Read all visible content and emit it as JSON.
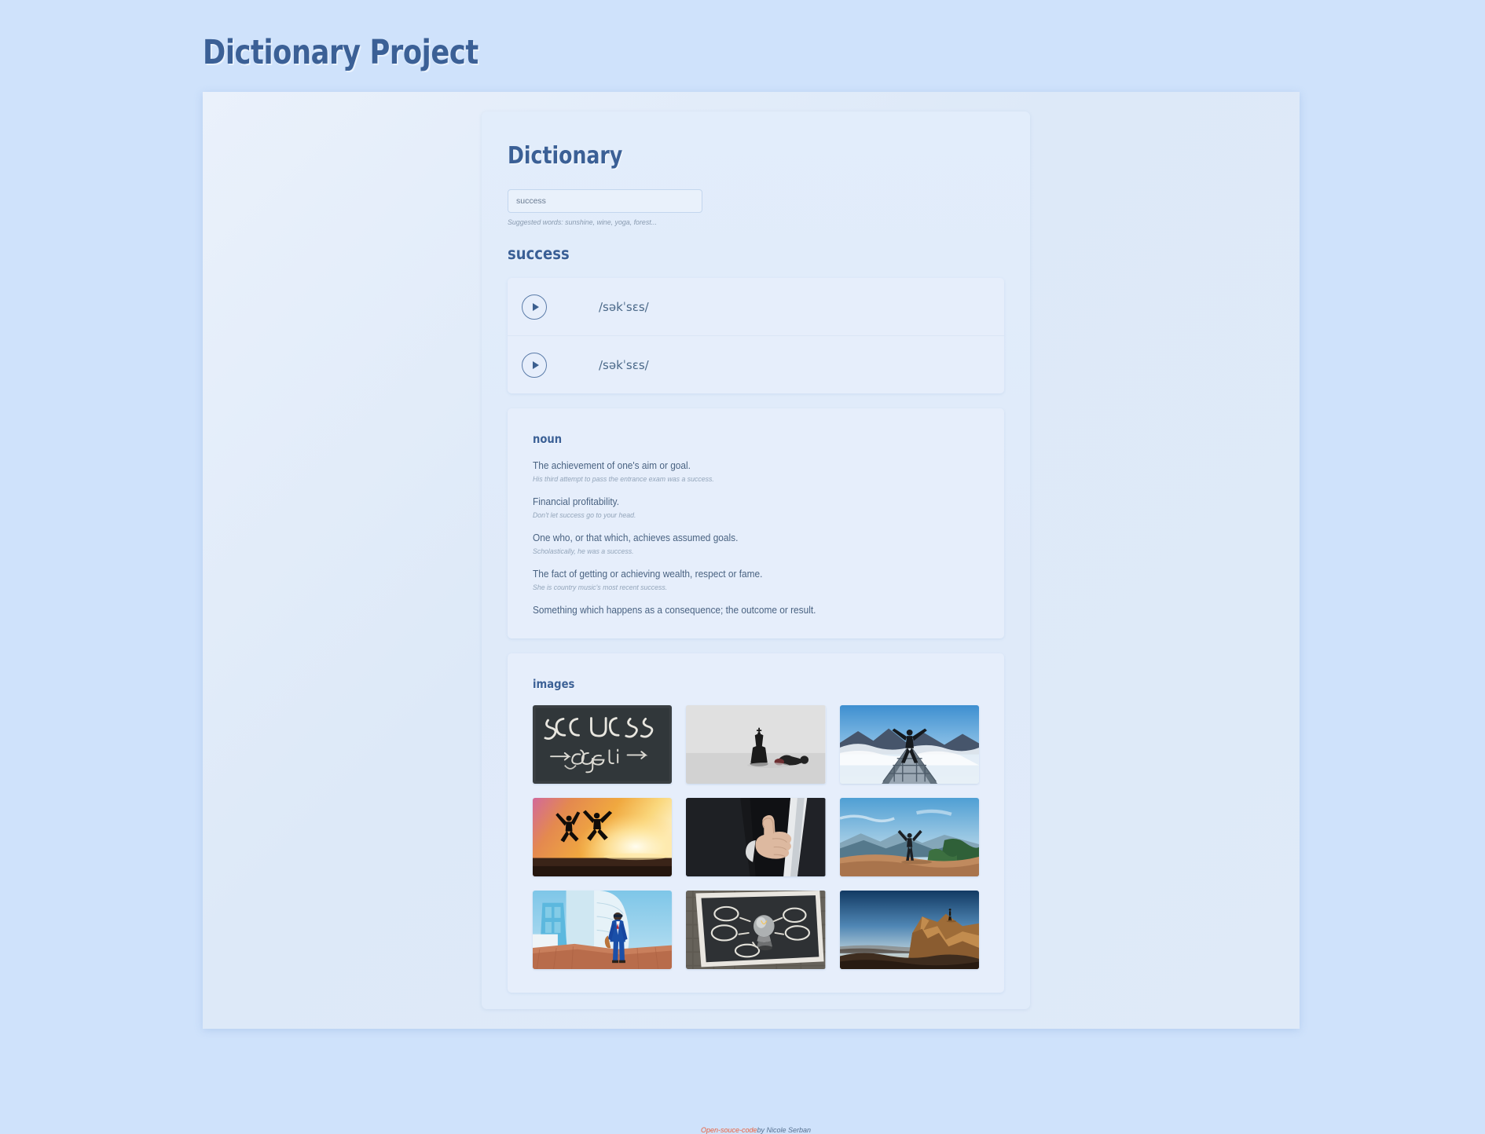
{
  "page": {
    "title": "Dictionary Project",
    "background_color": "#cfe2fb",
    "accent_color": "#3b6096"
  },
  "card": {
    "heading": "Dictionary"
  },
  "search": {
    "value": "success",
    "placeholder": "success",
    "hint": "Suggested words: sunshine, wine, yoga, forest..."
  },
  "result": {
    "word": "success",
    "phonetics": [
      {
        "text": "/səkˈsɛs/",
        "play_label": "play-icon"
      },
      {
        "text": "/səkˈsɛs/",
        "play_label": "play-icon"
      }
    ],
    "meanings": [
      {
        "part_of_speech": "noun",
        "definitions": [
          {
            "definition": "The achievement of one's aim or goal.",
            "example": "His third attempt to pass the entrance exam was a success."
          },
          {
            "definition": "Financial profitability.",
            "example": "Don't let success go to your head."
          },
          {
            "definition": "One who, or that which, achieves assumed goals.",
            "example": "Scholastically, he was a success."
          },
          {
            "definition": "The fact of getting or achieving wealth, respect or fame.",
            "example": "She is country music's most recent success."
          },
          {
            "definition": "Something which happens as a consequence; the outcome or result.",
            "example": ""
          }
        ]
      }
    ]
  },
  "images": {
    "heading": "images",
    "items": [
      {
        "alt": "chalkboard-success-go-get-it"
      },
      {
        "alt": "chess-king-and-fallen-piece"
      },
      {
        "alt": "person-arms-raised-on-sky-bridge"
      },
      {
        "alt": "two-people-jumping-at-sunset-beach"
      },
      {
        "alt": "thumbs-up-in-business-suit"
      },
      {
        "alt": "person-arms-raised-on-mountain-ridge"
      },
      {
        "alt": "man-in-blue-suit-by-buildings"
      },
      {
        "alt": "lightbulb-on-chalkboard-idea-map"
      },
      {
        "alt": "person-standing-on-rocky-summit"
      }
    ]
  },
  "footer": {
    "link_text": "Open-souce-code",
    "by_text": "by Nicole Serban"
  }
}
